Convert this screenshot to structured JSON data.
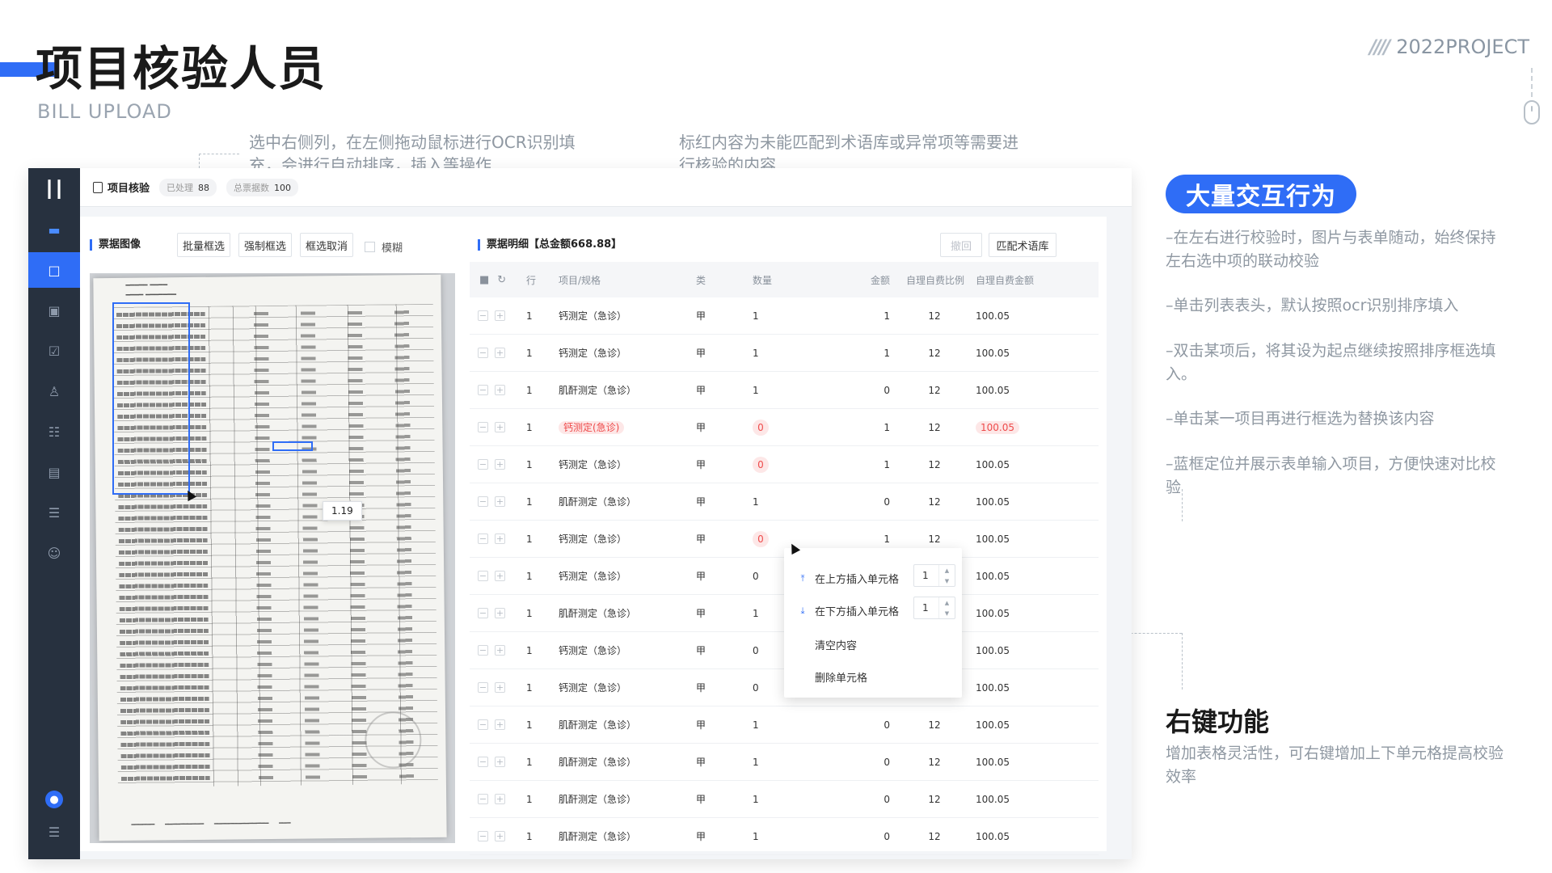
{
  "slide": {
    "title": "项目核验人员",
    "subtitle": "BILL UPLOAD",
    "project_tag": "2022PROJECT",
    "project_tag_prefix": "////"
  },
  "annotations": {
    "left": "选中右侧列，在左侧拖动鼠标进行OCR识别填充，会进行自动排序，插入等操作",
    "right": "标红内容为未能匹配到术语库或异常项等需要进行核验的内容"
  },
  "app": {
    "header": {
      "title": "项目核验",
      "processed_label": "已处理",
      "processed_value": "88",
      "total_label": "总票据数",
      "total_value": "100"
    },
    "left_panel": {
      "title": "票据图像",
      "buttons": [
        "批量框选",
        "强制框选",
        "框选取消"
      ],
      "checkbox_label": "模糊",
      "ocr_value": "1.19"
    },
    "right_panel": {
      "title": "票据明细【总金额668.88】",
      "undo_label": "撤回",
      "match_label": "匹配术语库"
    },
    "table": {
      "columns": [
        "行",
        "项目/规格",
        "类",
        "数量",
        "金额",
        "自理自费比例",
        "自理自费金额"
      ],
      "rows": [
        {
          "row": "1",
          "item": "钙测定（急诊）",
          "cls": "甲",
          "qty": "1",
          "amt": "1",
          "ratio": "12",
          "self": "100.05"
        },
        {
          "row": "1",
          "item": "钙测定（急诊）",
          "cls": "甲",
          "qty": "1",
          "amt": "1",
          "ratio": "12",
          "self": "100.05"
        },
        {
          "row": "1",
          "item": "肌酐测定（急诊）",
          "cls": "甲",
          "qty": "1",
          "amt": "0",
          "ratio": "12",
          "self": "100.05"
        },
        {
          "row": "1",
          "item": "钙测定(急诊)",
          "cls": "甲",
          "qty": "0",
          "amt": "1",
          "ratio": "12",
          "self": "100.05"
        },
        {
          "row": "1",
          "item": "钙测定（急诊）",
          "cls": "甲",
          "qty": "0",
          "amt": "1",
          "ratio": "12",
          "self": "100.05"
        },
        {
          "row": "1",
          "item": "肌酐测定（急诊）",
          "cls": "甲",
          "qty": "1",
          "amt": "0",
          "ratio": "12",
          "self": "100.05"
        },
        {
          "row": "1",
          "item": "钙测定（急诊）",
          "cls": "甲",
          "qty": "0",
          "amt": "1",
          "ratio": "12",
          "self": "100.05"
        },
        {
          "row": "1",
          "item": "钙测定（急诊）",
          "cls": "甲",
          "qty": "0",
          "amt": "",
          "ratio": "",
          "self": "100.05"
        },
        {
          "row": "1",
          "item": "肌酐测定（急诊）",
          "cls": "甲",
          "qty": "1",
          "amt": "",
          "ratio": "",
          "self": "100.05"
        },
        {
          "row": "1",
          "item": "钙测定（急诊）",
          "cls": "甲",
          "qty": "0",
          "amt": "",
          "ratio": "",
          "self": "100.05"
        },
        {
          "row": "1",
          "item": "钙测定（急诊）",
          "cls": "甲",
          "qty": "0",
          "amt": "",
          "ratio": "",
          "self": "100.05"
        },
        {
          "row": "1",
          "item": "肌酐测定（急诊）",
          "cls": "甲",
          "qty": "1",
          "amt": "0",
          "ratio": "12",
          "self": "100.05"
        },
        {
          "row": "1",
          "item": "肌酐测定（急诊）",
          "cls": "甲",
          "qty": "1",
          "amt": "0",
          "ratio": "12",
          "self": "100.05"
        },
        {
          "row": "1",
          "item": "肌酐测定（急诊）",
          "cls": "甲",
          "qty": "1",
          "amt": "0",
          "ratio": "12",
          "self": "100.05"
        },
        {
          "row": "1",
          "item": "肌酐测定（急诊）",
          "cls": "甲",
          "qty": "1",
          "amt": "0",
          "ratio": "12",
          "self": "100.05"
        }
      ]
    },
    "context_menu": {
      "insert_above": "在上方插入单元格",
      "insert_above_value": "1",
      "insert_below": "在下方插入单元格",
      "insert_below_value": "1",
      "clear": "清空内容",
      "delete": "删除单元格"
    }
  },
  "notes": {
    "badge": "大量交互行为",
    "items": [
      "–在左右进行校验时，图片与表单随动，始终保持左右选中项的联动校验",
      "–单击列表表头，默认按照ocr识别排序填入",
      "–双击某项后，将其设为起点继续按照排序框选填入。",
      "–单击某一项目再进行框选为替换该内容",
      "–蓝框定位并展示表单输入项目，方便快速对比校验"
    ],
    "right_click_title": "右键功能",
    "right_click_desc": "增加表格灵活性，可右键增加上下单元格提高校验效率"
  },
  "colors": {
    "accent": "#2f6df6",
    "sidebar": "#27313f",
    "error_bg": "#fde7e7",
    "error_text": "#ee4b4b"
  },
  "icons": [
    "logo-icon",
    "message-icon",
    "document-icon",
    "archive-icon",
    "checklist-icon",
    "stamp-icon",
    "report-icon",
    "briefcase-icon",
    "list-settings-icon",
    "user-settings-icon",
    "trash-icon",
    "refresh-icon",
    "mouse-icon"
  ]
}
